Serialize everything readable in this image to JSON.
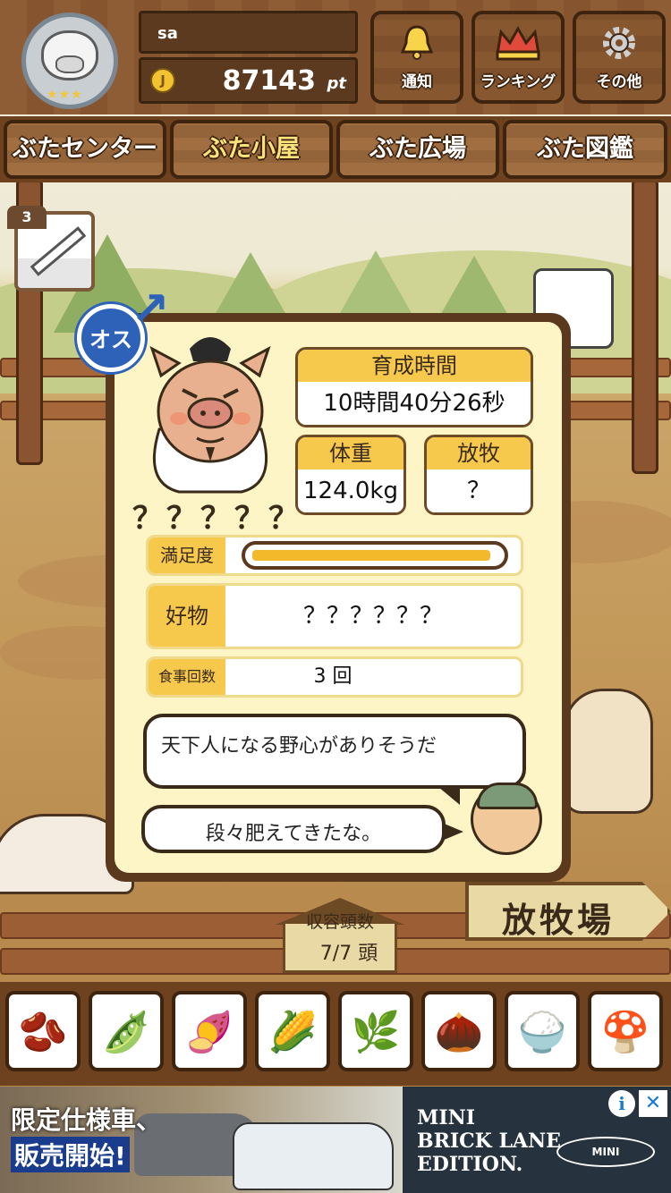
{
  "player": {
    "name": "sa",
    "points": "87143",
    "points_unit": "pt",
    "coin_icon": "coin-icon",
    "rank_stars": "★★★"
  },
  "top_buttons": [
    {
      "label": "通知",
      "icon": "bell-icon"
    },
    {
      "label": "ランキング",
      "icon": "crown-icon"
    },
    {
      "label": "その他",
      "icon": "gear-icon"
    }
  ],
  "tabs": [
    {
      "label": "ぶたセンター",
      "active": false
    },
    {
      "label": "ぶた小屋",
      "active": true
    },
    {
      "label": "ぶた広場",
      "active": false
    },
    {
      "label": "ぶた図鑑",
      "active": false
    }
  ],
  "medicine": {
    "count": "3",
    "icon": "syringe-icon"
  },
  "pig": {
    "gender": "オス",
    "name": "？？？？？",
    "growth_time_label": "育成時間",
    "growth_time": "10時間40分26秒",
    "weight_label": "体重",
    "weight": "124.0kg",
    "grazing_label": "放牧",
    "grazing": "？",
    "satisfaction_label": "満足度",
    "satisfaction_level": 0.97,
    "favorite_label": "好物",
    "favorite": "？？？？？？",
    "meals_label": "食事回数",
    "meals": "3 回",
    "description": "天下人になる野心がありそうだ",
    "farmer_comment": "段々肥えてきたな。"
  },
  "capacity": {
    "label": "収容頭数",
    "value": "7/7 頭"
  },
  "pasture_sign": "放牧場",
  "foods": [
    {
      "icon": "grain-pile-icon",
      "glyph": "🫘"
    },
    {
      "icon": "green-grain-pile-icon",
      "glyph": "🫛"
    },
    {
      "icon": "sweet-potato-icon",
      "glyph": "🍠"
    },
    {
      "icon": "corn-icon",
      "glyph": "🌽"
    },
    {
      "icon": "soybeans-icon",
      "glyph": "🌿"
    },
    {
      "icon": "acorn-icon",
      "glyph": "🌰"
    },
    {
      "icon": "rice-bowl-icon",
      "glyph": "🍚"
    },
    {
      "icon": "truffle-plate-icon",
      "glyph": "🍄"
    }
  ],
  "ad": {
    "headline1": "限定仕様車、",
    "headline2": "販売開始!",
    "text": "MINI\nBRICK LANE\nEDITION.",
    "brand": "MINI",
    "info": "i",
    "close": "✕"
  },
  "colors": {
    "accent_yellow": "#f6c94c",
    "wood_dark": "#5a391f",
    "panel_bg": "#fdf5c6",
    "male_blue": "#2e62b9"
  }
}
